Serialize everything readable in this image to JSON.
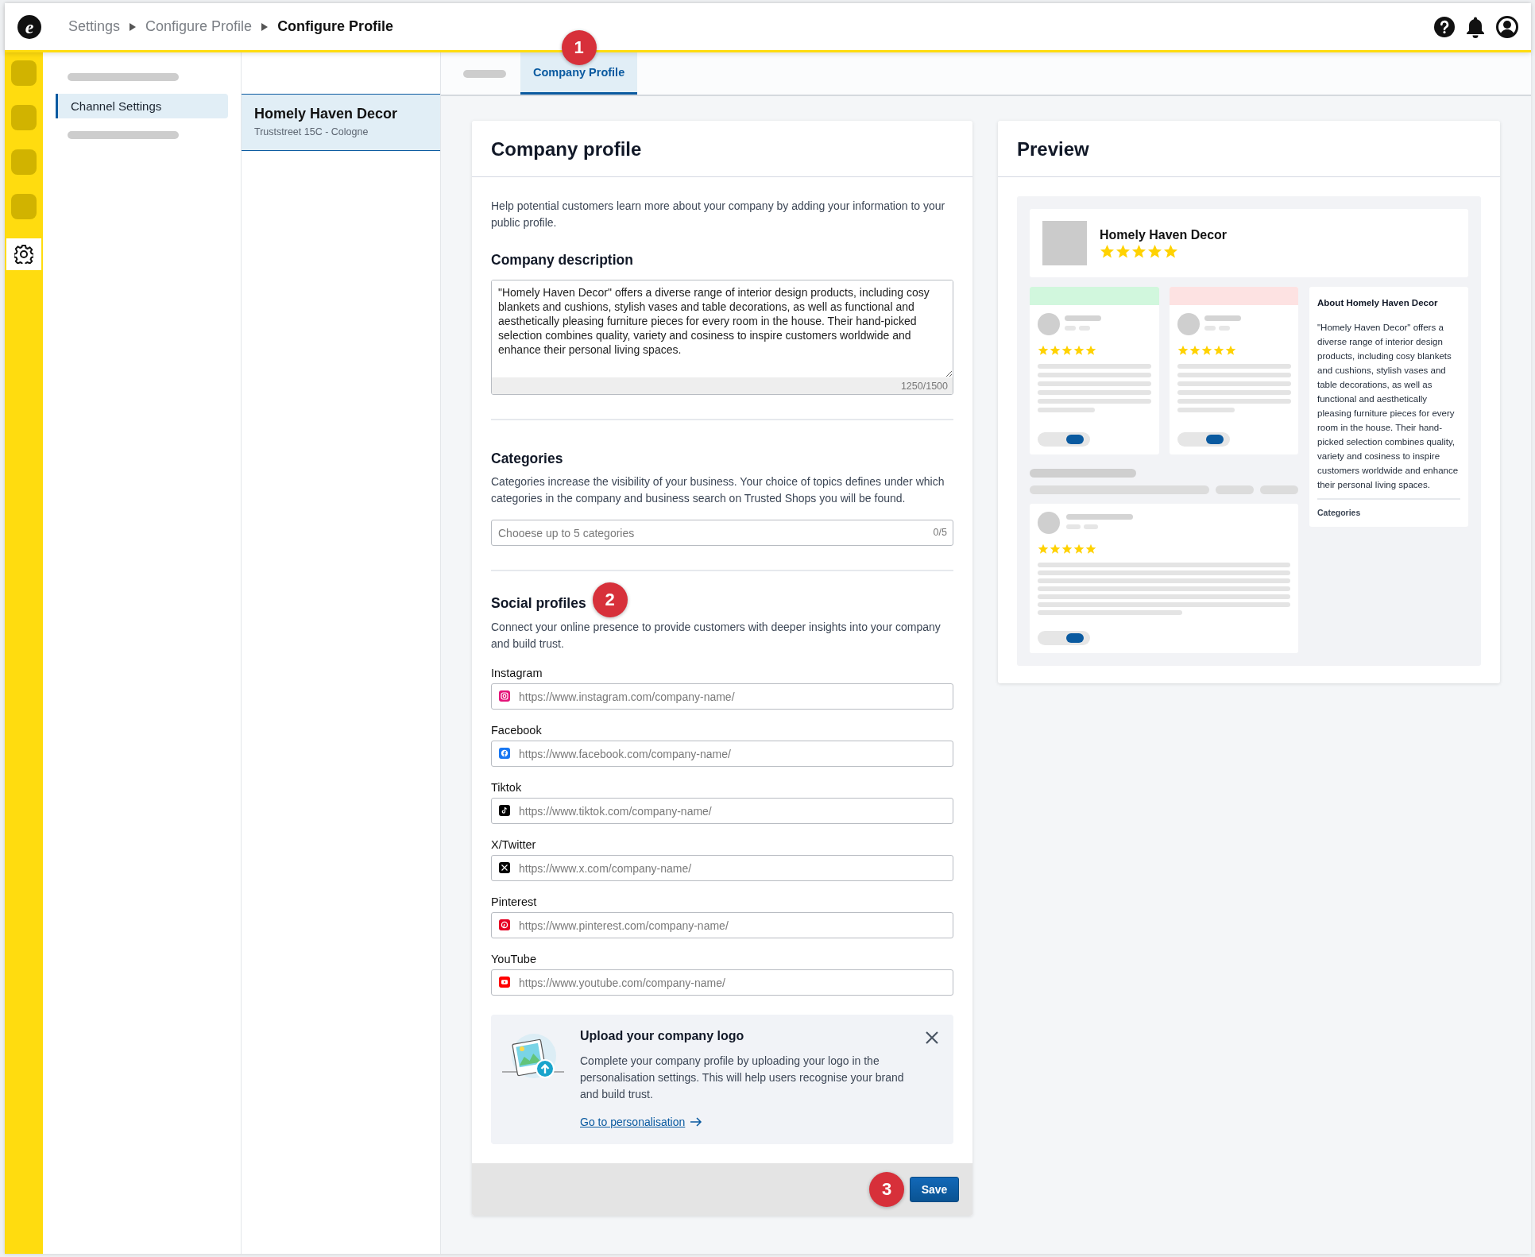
{
  "logo": {
    "letter": "e"
  },
  "breadcrumbs": [
    {
      "label": "Settings",
      "current": false
    },
    {
      "label": "Configure Profile",
      "current": false
    },
    {
      "label": "Configure Profile",
      "current": true
    }
  ],
  "rail": {
    "items": [
      {
        "kind": "placeholder",
        "selected": false
      },
      {
        "kind": "placeholder",
        "selected": false
      },
      {
        "kind": "placeholder",
        "selected": false
      },
      {
        "kind": "placeholder",
        "selected": false
      },
      {
        "kind": "settings",
        "selected": true
      }
    ]
  },
  "nav": {
    "items": [
      {
        "kind": "skeleton"
      },
      {
        "kind": "link",
        "label": "Channel Settings",
        "selected": true
      },
      {
        "kind": "skeleton"
      }
    ]
  },
  "shops": [
    {
      "name": "Homely Haven Decor",
      "address": "Truststreet 15C - Cologne",
      "selected": true
    }
  ],
  "tabs": [
    {
      "kind": "skeleton",
      "selected": false
    },
    {
      "kind": "label",
      "label": "Company Profile",
      "selected": true,
      "callout": "1"
    }
  ],
  "form": {
    "title": "Company profile",
    "intro": "Help potential customers learn more about your company by adding your information to your public profile.",
    "description": {
      "heading": "Company description",
      "value": "\"Homely Haven Decor\" offers a diverse range of interior design products, including cosy blankets and cushions, stylish vases and table decorations, as well as functional and aesthetically pleasing furniture pieces for every room in the house. Their hand-picked selection combines quality, variety and cosiness to inspire customers worldwide and enhance their personal living spaces.",
      "counter": "1250/1500"
    },
    "categories": {
      "heading": "Categories",
      "text": "Categories increase the visibility of your business. Your choice of topics defines under which categories in the company and business search on Trusted Shops you will be found.",
      "placeholder": "Chooese up to 5 categories",
      "counter": "0/5"
    },
    "social": {
      "heading": "Social profiles",
      "callout": "2",
      "text": "Connect your online presence to provide customers with deeper insights into your company and build trust.",
      "fields": [
        {
          "kind": "instagram",
          "label": "Instagram",
          "placeholder": "https://www.instagram.com/company-name/"
        },
        {
          "kind": "facebook",
          "label": "Facebook",
          "placeholder": "https://www.facebook.com/company-name/"
        },
        {
          "kind": "tiktok",
          "label": "Tiktok",
          "placeholder": "https://www.tiktok.com/company-name/"
        },
        {
          "kind": "x",
          "label": "X/Twitter",
          "placeholder": "https://www.x.com/company-name/"
        },
        {
          "kind": "pinterest",
          "label": "Pinterest",
          "placeholder": "https://www.pinterest.com/company-name/"
        },
        {
          "kind": "youtube",
          "label": "YouTube",
          "placeholder": "https://www.youtube.com/company-name/"
        }
      ]
    },
    "upload_notice": {
      "title": "Upload your company logo",
      "text": "Complete your company profile by uploading your logo in the personalisation settings. This will help users recognise your brand and build trust.",
      "link": "Go to personalisation"
    },
    "footer": {
      "callout": "3",
      "save_label": "Save"
    }
  },
  "preview": {
    "title": "Preview",
    "company": {
      "name": "Homely Haven Decor",
      "stars": 5
    },
    "review_cards": [
      {
        "color": "#d1f7dd",
        "stars": 5,
        "on": true
      },
      {
        "color": "#fde2e2",
        "stars": 5,
        "on": true
      }
    ],
    "featured_review": {
      "stars": 5,
      "on": true
    },
    "about": {
      "title": "About Homely Haven Decor",
      "text": "\"Homely Haven Decor\" offers a diverse range of interior design products, including cosy blankets and cushions, stylish vases and table decorations, as well as functional and aesthetically pleasing furniture pieces for every room in the house. Their hand-picked selection combines quality, variety and cosiness to inspire customers worldwide and enhance their personal living spaces.",
      "categories_label": "Categories"
    }
  }
}
